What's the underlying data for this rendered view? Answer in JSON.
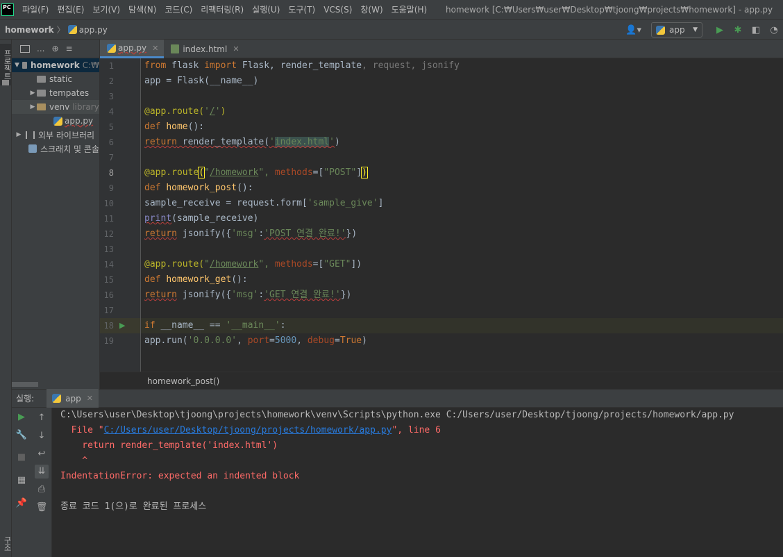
{
  "menu": {
    "logo_text": "PC",
    "items": [
      "파일(F)",
      "편집(E)",
      "보기(V)",
      "탐색(N)",
      "코드(C)",
      "리팩터링(R)",
      "실행(U)",
      "도구(T)",
      "VCS(S)",
      "창(W)",
      "도움말(H)"
    ],
    "window_title": "homework [C:₩Users₩user₩Desktop₩tjoong₩projects₩homework] - app.py"
  },
  "navbar": {
    "project": "homework",
    "file": "app.py",
    "run_config": "app"
  },
  "side": {
    "project_tab": "프로젝트",
    "structure_tab": "구조"
  },
  "project_panel": {
    "toolbar_label": "...",
    "tree": {
      "root": "homework",
      "root_hint": "C:₩",
      "static": "static",
      "templates": "tempates",
      "venv": "venv",
      "venv_hint": "library",
      "app": "app.py",
      "external": "외부 라이브러리",
      "scratch": "스크래치 및 콘솔"
    }
  },
  "tabs": [
    {
      "label": "app.py",
      "active": true
    },
    {
      "label": "index.html",
      "active": false
    }
  ],
  "editor": {
    "line_numbers": [
      "1",
      "2",
      "3",
      "4",
      "5",
      "6",
      "7",
      "8",
      "9",
      "10",
      "11",
      "12",
      "13",
      "14",
      "15",
      "16",
      "17",
      "18",
      "19"
    ],
    "current_line": 8,
    "breadcrumb": "homework_post()"
  },
  "code": {
    "l1": {
      "a": "from",
      "b": " flask ",
      "c": "import",
      "d": " Flask, render_template",
      "e": ", request, jsonify"
    },
    "l2": {
      "a": "app = Flask(__name__)"
    },
    "l4": {
      "a": "@app.route(",
      "b": "'",
      "c": "/",
      "d": "'",
      "e": ")"
    },
    "l5": {
      "a": "def",
      "b": " ",
      "c": "home",
      "d": "():"
    },
    "l6": {
      "a": "return",
      "b": " render_template(",
      "c": "'",
      "d": "index.html",
      "e": "'",
      "f": ")"
    },
    "l8": {
      "a": "@app.route",
      "b": "(",
      "c": "\"",
      "d": "/homework",
      "e": "\", ",
      "f": "methods",
      "g": "=[",
      "h": "\"POST\"",
      "i": "]",
      "j": ")"
    },
    "l9": {
      "a": "def",
      "b": " ",
      "c": "homework_post",
      "d": "():"
    },
    "l10": {
      "a": "sample_receive = request.form[",
      "b": "'sample_give'",
      "c": "]"
    },
    "l11": {
      "a": "print",
      "b": "(sample_receive)"
    },
    "l12": {
      "a": "return",
      "b": " jsonify({",
      "c": "'msg'",
      "d": ":",
      "e": "'POST 연결 완료!'",
      "f": "})"
    },
    "l14": {
      "a": "@app.route(",
      "b": "\"",
      "c": "/homework",
      "d": "\", ",
      "e": "methods",
      "f": "=[",
      "g": "\"GET\"",
      "h": "])"
    },
    "l15": {
      "a": "def",
      "b": " ",
      "c": "homework_get",
      "d": "():"
    },
    "l16": {
      "a": "return",
      "b": " jsonify({",
      "c": "'msg'",
      "d": ":",
      "e": "'GET 연결 완료!'",
      "f": "})"
    },
    "l18": {
      "a": "if",
      "b": " __name__ == ",
      "c": "'__main__'",
      "d": ":"
    },
    "l19": {
      "a": "app.run(",
      "b": "'0.0.0.0'",
      "c": ", ",
      "d": "port",
      "e": "=",
      "f": "5000",
      "g": ", ",
      "h": "debug",
      "i": "=",
      "j": "True",
      "k": ")"
    }
  },
  "run": {
    "header_label": "실행:",
    "tab_label": "app",
    "console": {
      "cmd": "C:\\Users\\user\\Desktop\\tjoong\\projects\\homework\\venv\\Scripts\\python.exe C:/Users/user/Desktop/tjoong/projects/homework/app.py",
      "file_prefix": "  File \"",
      "file_link": "C:/Users/user/Desktop/tjoong/projects/homework/app.py",
      "file_suffix": "\", line 6",
      "source": "    return render_template('index.html')",
      "caret": "    ^",
      "error": "IndentationError: expected an indented block",
      "exit": "종료 코드 1(으)로 완료된 프로세스"
    }
  },
  "icons": {
    "python": "python-file-icon",
    "html": "html-file-icon",
    "folder": "folder-icon",
    "run": "run-icon",
    "debug": "debug-icon"
  },
  "colors": {
    "keyword": "#cc7832",
    "string": "#6a8759",
    "decorator": "#bbb529",
    "function": "#ffc66d",
    "number": "#6897bb",
    "error": "#ff6b68",
    "link": "#287bde",
    "run_green": "#499c54"
  }
}
